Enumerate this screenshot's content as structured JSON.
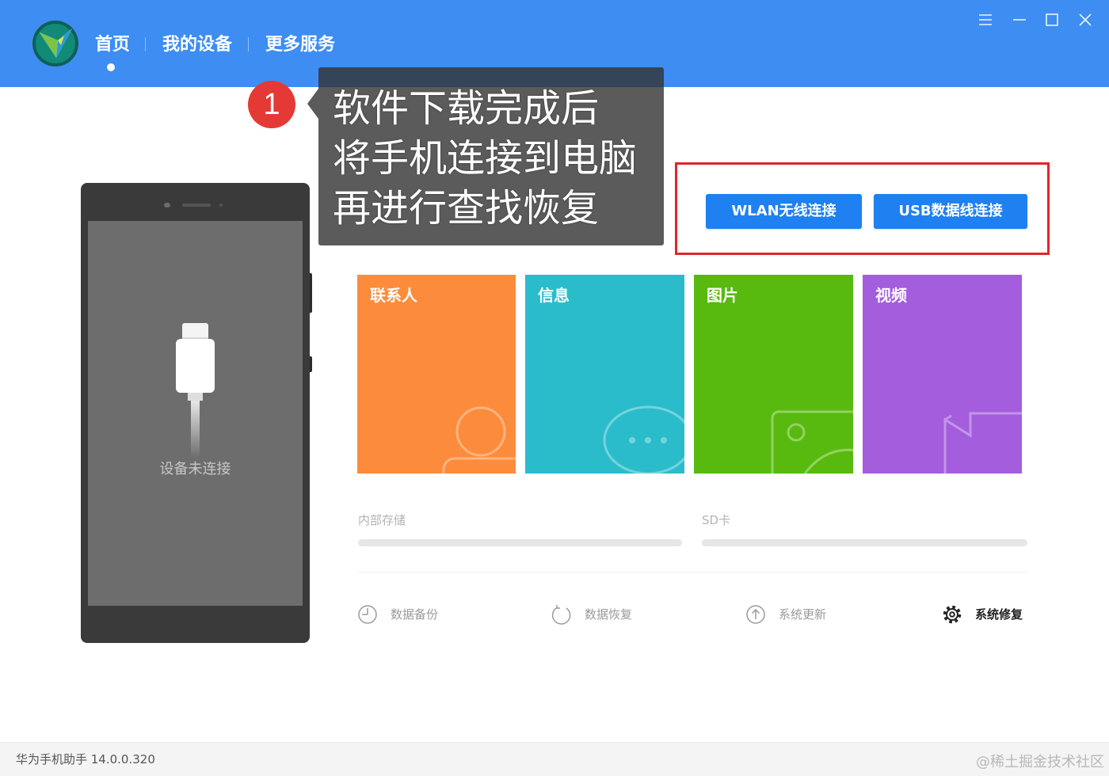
{
  "app": {
    "version_text": "华为手机助手 14.0.0.320"
  },
  "colors": {
    "header": "#3d8df2",
    "primary_button": "#1e80f1",
    "highlight": "#e0262a",
    "step_badge": "#e53935"
  },
  "header": {
    "logo_icon": "hisuite-logo-icon",
    "nav": [
      {
        "label": "首页",
        "active": true
      },
      {
        "label": "我的设备",
        "active": false
      },
      {
        "label": "更多服务",
        "active": false
      }
    ],
    "window_controls": [
      {
        "icon": "menu-icon"
      },
      {
        "icon": "minimize-icon"
      },
      {
        "icon": "maximize-icon"
      },
      {
        "icon": "close-icon"
      }
    ]
  },
  "device": {
    "status": "设备未连接",
    "illustration_icon": "usb-plug-icon"
  },
  "annotation": {
    "step": "1",
    "lines": [
      "软件下载完成后",
      "将手机连接到电脑",
      "再进行查找恢复"
    ]
  },
  "connect": {
    "wlan_label": "WLAN无线连接",
    "usb_label": "USB数据线连接"
  },
  "tiles": [
    {
      "label": "联系人",
      "color": "#fc8c3c",
      "icon": "contact-icon"
    },
    {
      "label": "信息",
      "color": "#2bbccb",
      "icon": "message-icon"
    },
    {
      "label": "图片",
      "color": "#58ba0e",
      "icon": "picture-icon"
    },
    {
      "label": "视频",
      "color": "#a45ddc",
      "icon": "video-icon"
    }
  ],
  "storage": [
    {
      "label": "内部存储"
    },
    {
      "label": "SD卡"
    }
  ],
  "actions": [
    {
      "label": "数据备份",
      "icon": "clock-icon"
    },
    {
      "label": "数据恢复",
      "icon": "refresh-icon"
    },
    {
      "label": "系统更新",
      "icon": "upload-icon"
    },
    {
      "label": "系统修复",
      "icon": "gear-icon"
    }
  ],
  "watermark": "@稀土掘金技术社区"
}
